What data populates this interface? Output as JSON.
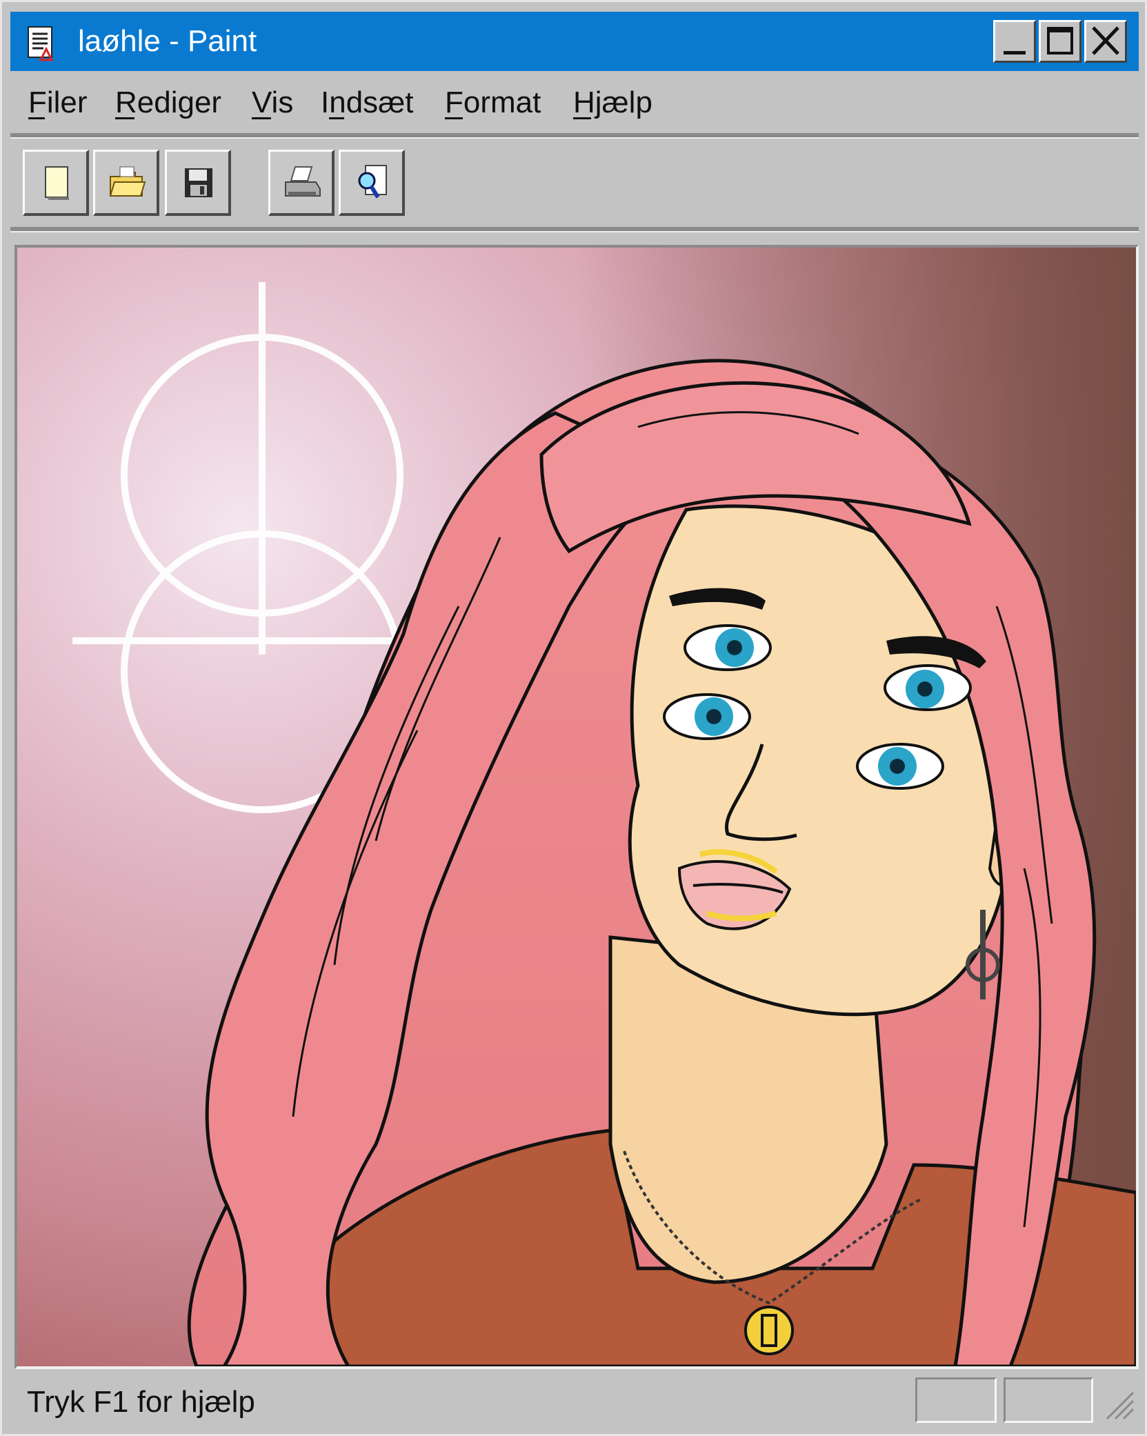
{
  "window": {
    "title": "laøhle - Paint",
    "titlebar_color": "#0a7ad0",
    "controls": [
      "minimize-icon",
      "maximize-icon",
      "close-icon"
    ]
  },
  "menu": {
    "items": [
      {
        "label": "Filer"
      },
      {
        "label": "Rediger"
      },
      {
        "label": "Vis"
      },
      {
        "label": "Indsæt"
      },
      {
        "label": "Format"
      },
      {
        "label": "Hjælp"
      }
    ]
  },
  "toolbar": {
    "buttons": [
      {
        "icon": "new-document-icon"
      },
      {
        "icon": "open-folder-icon"
      },
      {
        "icon": "save-disk-icon"
      },
      {
        "icon": "print-icon"
      },
      {
        "icon": "print-preview-icon"
      }
    ]
  },
  "canvas": {
    "content": "illustration-portrait"
  },
  "status": {
    "text": "Tryk F1 for hjælp"
  }
}
